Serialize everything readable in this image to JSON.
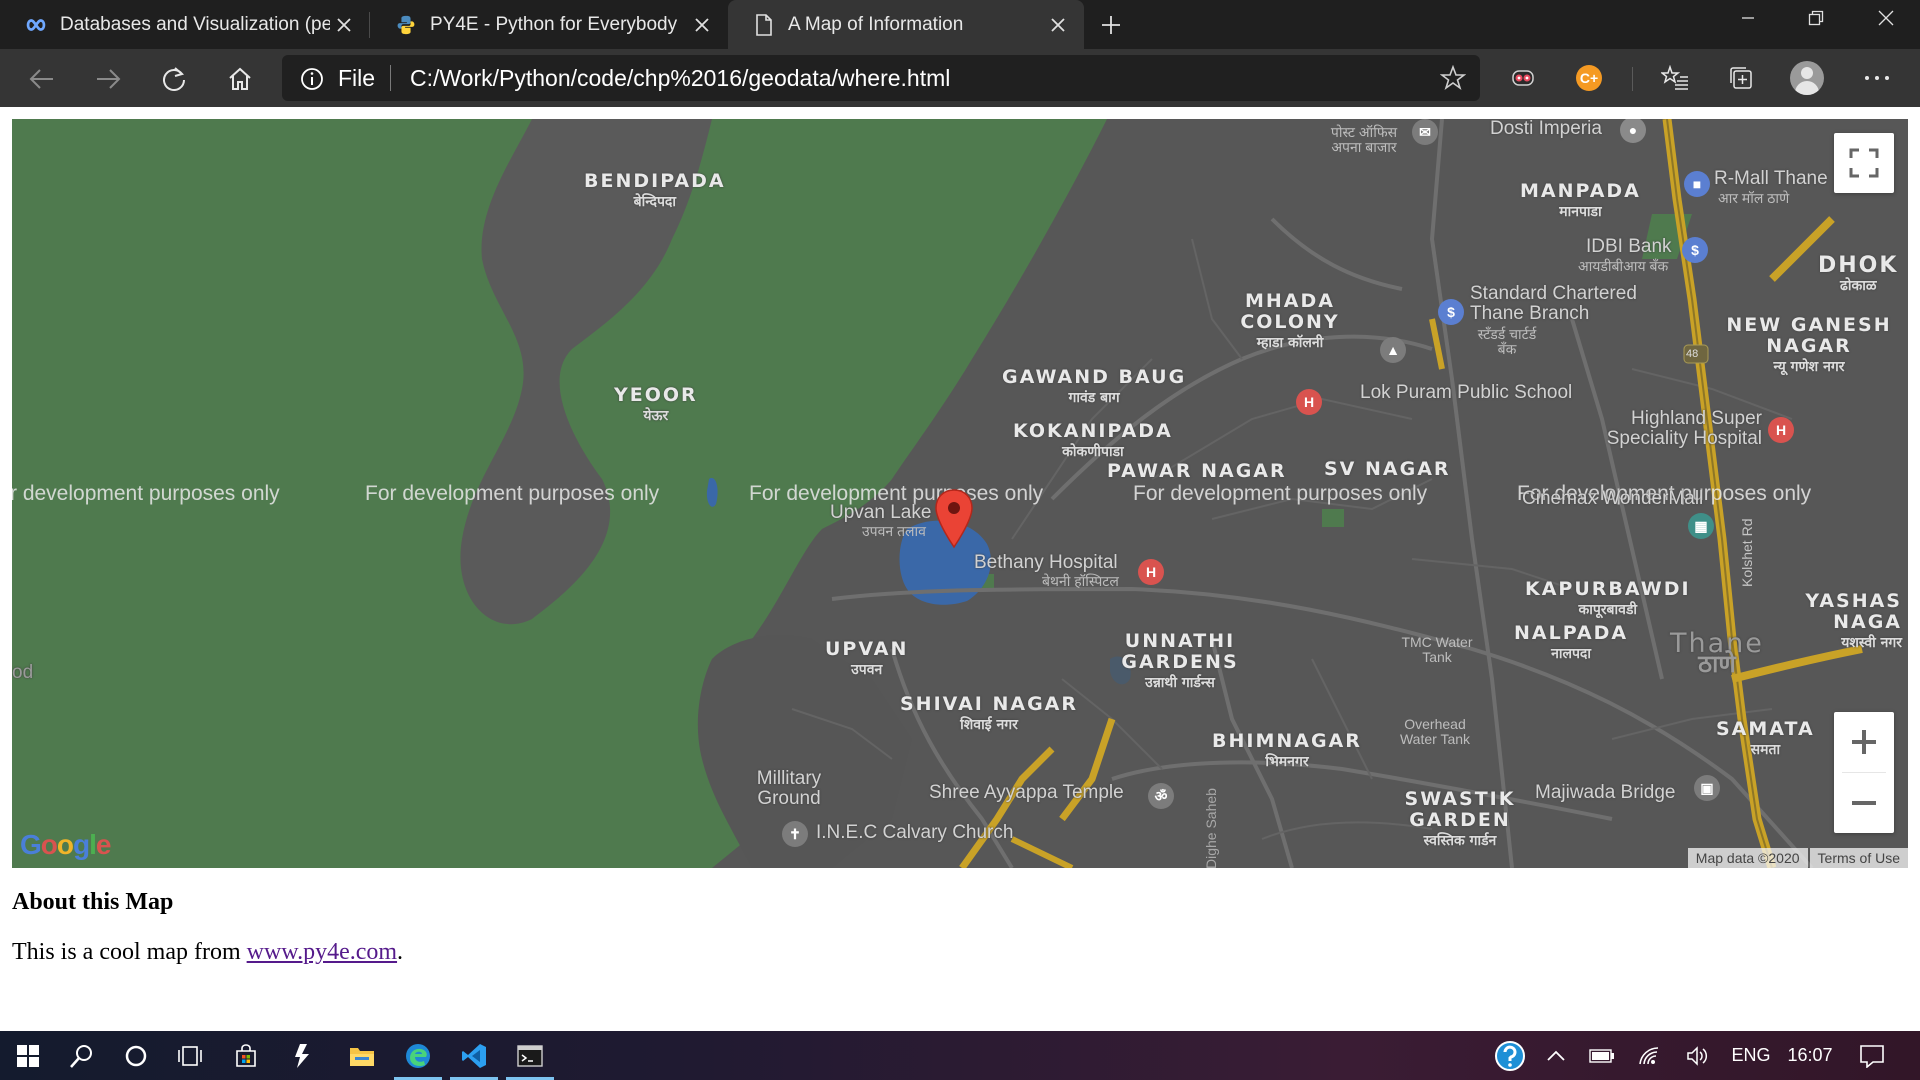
{
  "browser": {
    "tabs": [
      {
        "title": "Databases and Visualization (peer",
        "icon": "coursera-infinity-icon",
        "active": false
      },
      {
        "title": "PY4E - Python for Everybody",
        "icon": "python-logo-icon",
        "active": false
      },
      {
        "title": "A Map of Information",
        "icon": "document-icon",
        "active": true
      }
    ],
    "address": {
      "scheme_label": "File",
      "url": "C:/Work/Python/code/chp%2016/geodata/where.html"
    },
    "extension_badge": "C+"
  },
  "map": {
    "watermark": "For development purposes only",
    "watermark_partial_left": "r development purposes only",
    "area_labels": [
      {
        "en": "BENDIPADA",
        "hi": "बेन्दिपदा"
      },
      {
        "en": "YEOOR",
        "hi": "येऊर"
      },
      {
        "en": "GAWAND BAUG",
        "hi": "गावंड बाग"
      },
      {
        "en": "KOKANIPADA",
        "hi": "कोकणीपाडा"
      },
      {
        "en": "PAWAR NAGAR",
        "hi": ""
      },
      {
        "en": "SV NAGAR",
        "hi": ""
      },
      {
        "en": "MHADA COLONY",
        "hi": "म्हाडा कॉलनी"
      },
      {
        "en": "MANPADA",
        "hi": "मानपाडा"
      },
      {
        "en": "DHOK",
        "hi": "ढोकाळ"
      },
      {
        "en": "NEW GANESH NAGAR",
        "hi": "न्यू गणेश नगर"
      },
      {
        "en": "KAPURBAWDI",
        "hi": "कापूरबावडी"
      },
      {
        "en": "NALPADA",
        "hi": "नालपदा"
      },
      {
        "en": "YASHAS NAGA",
        "hi": "यशस्वी नगर"
      },
      {
        "en": "UPVAN",
        "hi": "उपवन"
      },
      {
        "en": "UNNATHI GARDENS",
        "hi": "उन्नाथी गार्डन्स"
      },
      {
        "en": "SHIVAI NAGAR",
        "hi": "शिवाई नगर"
      },
      {
        "en": "BHIMNAGAR",
        "hi": "भिमनगर"
      },
      {
        "en": "SWASTIK GARDEN",
        "hi": "स्वस्तिक गार्डन"
      },
      {
        "en": "SAMATA",
        "hi": "समता"
      },
      {
        "en": "Thane",
        "hi": "ठाणे"
      }
    ],
    "places": {
      "dosti": "Dosti Imperia",
      "post_office": "पोस्ट ऑफिस अपना बाजार",
      "rmall": "R-Mall Thane",
      "rmall_hi": "आर मॉल ठाणे",
      "idbi": "IDBI Bank",
      "idbi_hi": "आयडीबीआय बँक",
      "standard_chartered": "Standard Chartered Thane Branch",
      "standard_chartered_hi": "स्टँडर्ड चार्टर्ड बँक",
      "lok_puram": "Lok Puram Public School",
      "highland": "Highland Super Speciality Hospital",
      "cinemax": "Cinemax WonderMall",
      "upvan_lake": "Upvan Lake",
      "upvan_lake_hi": "उपवन तलाव",
      "bethany": "Bethany Hospital",
      "bethany_hi": "बेथनी हॉस्पिटल",
      "tmc_tank": "TMC Water Tank",
      "overhead_tank": "Overhead Water Tank",
      "military": "Millitary Ground",
      "ayyappa": "Shree Ayyappa Temple",
      "calvary": "I.N.E.C Calvary Church",
      "majiwada": "Majiwada Bridge",
      "kolshet": "Kolshet Rd",
      "dighe": "Dighe Saheb",
      "highway": "48",
      "edge_od": "od"
    },
    "logo": "Google",
    "attribution": {
      "data": "Map data ©2020",
      "terms": "Terms of Use"
    }
  },
  "content": {
    "heading": "About this Map",
    "text_before": "This is a cool map from ",
    "link": "www.py4e.com",
    "text_after": "."
  },
  "taskbar": {
    "language": "ENG",
    "time": "16:07",
    "apps": [
      "start-icon",
      "search-icon",
      "cortana-icon",
      "task-view-icon",
      "store-icon",
      "power-automate-icon",
      "file-explorer-icon",
      "edge-icon",
      "vscode-icon",
      "terminal-icon"
    ]
  },
  "colors": {
    "map_background": "#575757",
    "park_green": "#4f7a4e",
    "water": "#3a68a8",
    "marker_red": "#ea4335",
    "tab_active": "#353535",
    "titlebar": "#1f1f1f"
  }
}
